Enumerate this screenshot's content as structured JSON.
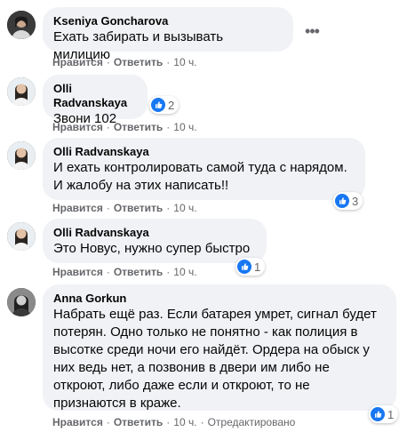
{
  "comments": [
    {
      "author": "Kseniya Goncharova",
      "text": "Ехать забирать и вызывать милицию",
      "like_label": "Нравится",
      "reply_label": "Ответить",
      "time": "10 ч.",
      "more_label": "•••"
    },
    {
      "author": "Olli Radvanskaya",
      "text": "Звони 102",
      "like_label": "Нравится",
      "reply_label": "Ответить",
      "time": "10 ч.",
      "reaction_count": "2"
    },
    {
      "author": "Olli Radvanskaya",
      "text": "И ехать контролировать самой туда с нарядом.\nИ жалобу на этих написать!!",
      "like_label": "Нравится",
      "reply_label": "Ответить",
      "time": "10 ч.",
      "reaction_count": "3"
    },
    {
      "author": "Olli Radvanskaya",
      "text": "Это Новус, нужно супер быстро",
      "like_label": "Нравится",
      "reply_label": "Ответить",
      "time": "10 ч.",
      "reaction_count": "1"
    },
    {
      "author": "Anna Gorkun",
      "text": "Набрать ещё раз. Если батарея умрет, сигнал будет\nпотерян. Одно только не понятно - как полиция в\nвысотке среди ночи его найдёт. Ордера на обыск у\nних ведь нет, а позвонив в двери им либо не\nоткроют, либо даже если и откроют, то не\nпризнаются в краже.",
      "like_label": "Нравится",
      "reply_label": "Ответить",
      "time": "10 ч.",
      "edited_label": "Отредактировано",
      "reaction_count": "1"
    }
  ],
  "colors": {
    "bubble": "#f0f2f5",
    "like_blue": "#1877f2",
    "meta_gray": "#65676b"
  },
  "icons": {
    "reaction": "thumbs-up-icon",
    "more": "more-dots-icon"
  }
}
